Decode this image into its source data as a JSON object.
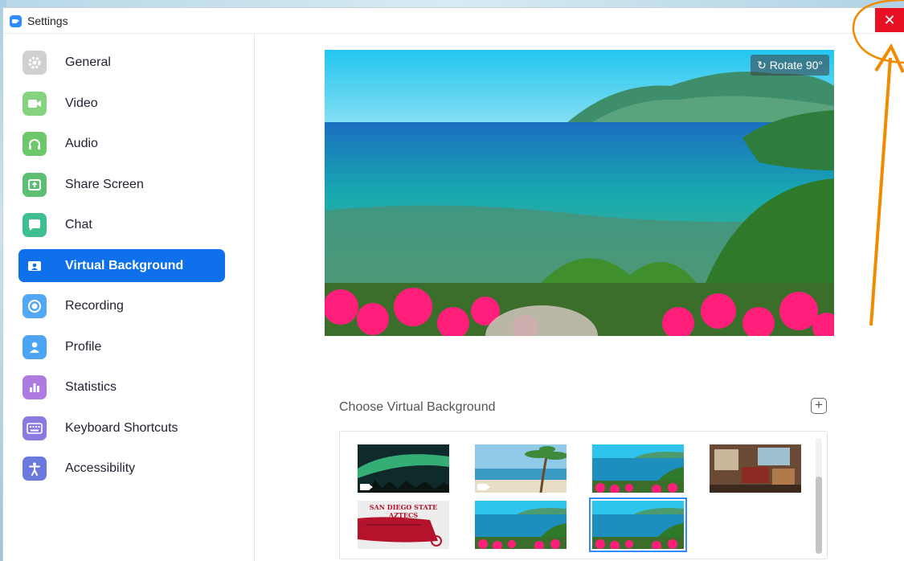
{
  "window": {
    "title": "Settings",
    "close_symbol": "✕"
  },
  "sidebar": {
    "items": [
      {
        "label": "General",
        "icon": "gear-icon",
        "color": "#cfcfcf",
        "active": false
      },
      {
        "label": "Video",
        "icon": "video-camera-icon",
        "color": "#7ed27a",
        "active": false
      },
      {
        "label": "Audio",
        "icon": "headphones-icon",
        "color": "#6cc86a",
        "active": false
      },
      {
        "label": "Share Screen",
        "icon": "share-screen-icon",
        "color": "#5cbf73",
        "active": false
      },
      {
        "label": "Chat",
        "icon": "chat-bubble-icon",
        "color": "#3fbf8f",
        "active": false
      },
      {
        "label": "Virtual Background",
        "icon": "person-card-icon",
        "color": "#0e71eb",
        "active": true
      },
      {
        "label": "Recording",
        "icon": "record-icon",
        "color": "#52a8f5",
        "active": false
      },
      {
        "label": "Profile",
        "icon": "person-icon",
        "color": "#4ca4f3",
        "active": false
      },
      {
        "label": "Statistics",
        "icon": "bar-chart-icon",
        "color": "#b07be0",
        "active": false
      },
      {
        "label": "Keyboard Shortcuts",
        "icon": "keyboard-icon",
        "color": "#8a7be0",
        "active": false
      },
      {
        "label": "Accessibility",
        "icon": "accessibility-icon",
        "color": "#6b79dc",
        "active": false
      }
    ]
  },
  "main": {
    "rotate_label": "Rotate 90°",
    "choose_label": "Choose Virtual Background",
    "add_symbol": "+",
    "thumbnails": [
      {
        "name": "aurora"
      },
      {
        "name": "beach-palm"
      },
      {
        "name": "tropical-coast-1"
      },
      {
        "name": "living-room"
      },
      {
        "name": "sdsu-aztecs",
        "caption": "SAN DIEGO STATE AZTECS"
      },
      {
        "name": "tropical-coast-2"
      },
      {
        "name": "tropical-coast-3",
        "selected": true
      }
    ]
  },
  "colors": {
    "accent": "#0e71eb",
    "close_red": "#e81123",
    "annotation": "#f08a00"
  }
}
